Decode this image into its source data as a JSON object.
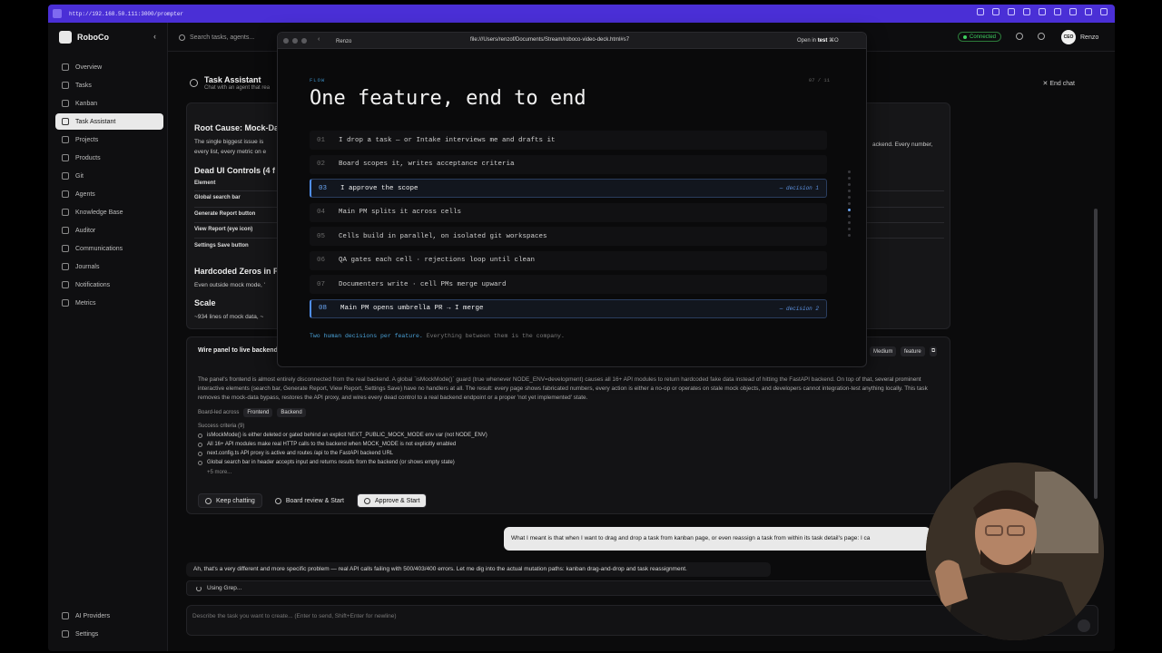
{
  "browser": {
    "url": "http://192.168.50.111:3000/prompter"
  },
  "sidebar": {
    "brand": "RoboCo",
    "items": [
      {
        "label": "Overview",
        "active": false
      },
      {
        "label": "Tasks",
        "active": false
      },
      {
        "label": "Kanban",
        "active": false
      },
      {
        "label": "Task Assistant",
        "active": true
      },
      {
        "label": "Projects",
        "active": false
      },
      {
        "label": "Products",
        "active": false
      },
      {
        "label": "Git",
        "active": false
      },
      {
        "label": "Agents",
        "active": false
      },
      {
        "label": "Knowledge Base",
        "active": false
      },
      {
        "label": "Auditor",
        "active": false
      },
      {
        "label": "Communications",
        "active": false
      },
      {
        "label": "Journals",
        "active": false
      },
      {
        "label": "Notifications",
        "active": false
      },
      {
        "label": "Metrics",
        "active": false
      }
    ],
    "bottom": [
      {
        "label": "AI Providers"
      },
      {
        "label": "Settings"
      }
    ]
  },
  "topbar": {
    "search_placeholder": "Search tasks, agents...",
    "status": "Connected",
    "user_initials": "CEO",
    "user_name": "Renzo"
  },
  "chat": {
    "title": "Task Assistant",
    "subtitle": "Chat with an agent that rea",
    "end_chat": "End chat"
  },
  "message": {
    "root_cause_heading": "Root Cause: Mock-Da",
    "root_cause_text_1": "The single biggest issue is",
    "root_cause_text_2": "every list, every metric on e",
    "root_cause_right": "ackend. Every number,",
    "dead_controls_heading": "Dead UI Controls (4 f",
    "table_header": "Element",
    "rows": [
      "Global search bar",
      "Generate Report button",
      "View Report (eye icon)",
      "Settings Save button"
    ],
    "hardcoded_heading": "Hardcoded Zeros in F",
    "hardcoded_text": "Even outside mock mode, '",
    "scale_heading": "Scale",
    "scale_text": "~934 lines of mock data, ~"
  },
  "task": {
    "title": "Wire panel to live backend",
    "tags": [
      "Medium",
      "feature"
    ],
    "description": "The panel's frontend is almost entirely disconnected from the real backend. A global `isMockMode()` guard (true whenever NODE_ENV=development) causes all 16+ API modules to return hardcoded fake data instead of hitting the FastAPI backend. On top of that, several prominent interactive elements (search bar, Generate Report, View Report, Settings Save) have no handlers at all. The result: every page shows fabricated numbers, every action is either a no-op or operates on stale mock objects, and developers cannot integration-test anything locally. This task removes the mock-data bypass, restores the API proxy, and wires every dead control to a real backend endpoint or a proper 'not yet implemented' state.",
    "led_label": "Board-led across",
    "led_chips": [
      "Frontend",
      "Backend"
    ],
    "success_label": "Success criteria (9)",
    "criteria": [
      "isMockMode() is either deleted or gated behind an explicit NEXT_PUBLIC_MOCK_MODE env var (not NODE_ENV)",
      "All 16+ API modules make real HTTP calls to the backend when MOCK_MODE is not explicitly enabled",
      "next.config.ts API proxy is active and routes /api to the FastAPI backend URL",
      "Global search bar in header accepts input and returns results from the backend (or shows empty state)"
    ],
    "more": "+5 more...",
    "buttons": {
      "keep": "Keep chatting",
      "board": "Board review & Start",
      "approve": "Approve & Start"
    }
  },
  "conversation": {
    "user": "What I meant is that when I want to drag and drop a task from kanban page, or even reassign a task from within its task detail's page: I ca",
    "assistant": "Ah, that's a very different and more specific problem — real API calls failing with 500/403/400 errors. Let me dig into the actual mutation paths: kanban drag-and-drop and task reassignment.",
    "tool": "Using Grep..."
  },
  "composer": {
    "placeholder": "Describe the task you want to create... (Enter to send, Shift+Enter for newline)"
  },
  "overlay": {
    "tab": "Renzo",
    "url": "file:///Users/renzof/Documents/Stream/roboco-video-deck.html#s7",
    "open_in_prefix": "Open in",
    "open_in_target": "test",
    "open_in_shortcut": "⌘O",
    "eyebrow": "FLOW",
    "page": "07 / 11",
    "title": "One feature, end to end",
    "steps": [
      {
        "num": "01",
        "text": "I drop a task — or Intake interviews me and drafts it",
        "decision": ""
      },
      {
        "num": "02",
        "text": "Board scopes it, writes acceptance criteria",
        "decision": ""
      },
      {
        "num": "03",
        "text": "I approve the scope",
        "decision": "— decision 1"
      },
      {
        "num": "04",
        "text": "Main PM splits it across cells",
        "decision": ""
      },
      {
        "num": "05",
        "text": "Cells build in parallel, on isolated git workspaces",
        "decision": ""
      },
      {
        "num": "06",
        "text": "QA gates each cell · rejections loop until clean",
        "decision": ""
      },
      {
        "num": "07",
        "text": "Documenters write · cell PMs merge upward",
        "decision": ""
      },
      {
        "num": "08",
        "text": "Main PM opens umbrella PR → I merge",
        "decision": "— decision 2"
      }
    ],
    "footer_accent": "Two human decisions per feature.",
    "footer_rest": "Everything between them is the company."
  }
}
